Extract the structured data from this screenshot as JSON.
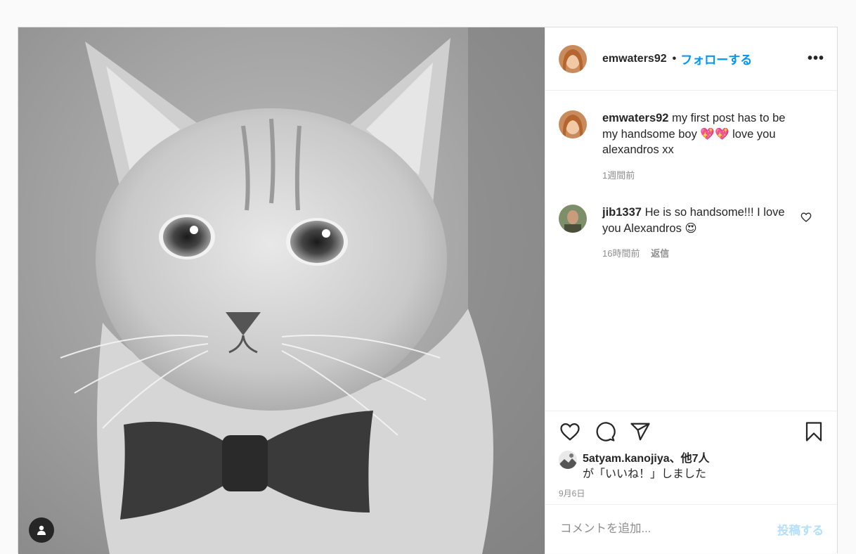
{
  "header": {
    "username": "emwaters92",
    "separator": "•",
    "follow_label": "フォローする",
    "more_label": "•••"
  },
  "caption": {
    "username": "emwaters92",
    "text": "my first post has to be my handsome boy 💖💖 love you alexandros xx",
    "time": "1週間前"
  },
  "comments": [
    {
      "username": "jib1337",
      "text": "He is so handsome!!! I love you Alexandros 😍",
      "time": "16時間前",
      "reply_label": "返信"
    }
  ],
  "likes": {
    "first_user": "5atyam.kanojiya",
    "joiner": "、",
    "others": "他7人",
    "suffix": "が「いいね！」しました"
  },
  "post_date": "9月6日",
  "comment_box": {
    "placeholder": "コメントを追加...",
    "post_label": "投稿する"
  },
  "colors": {
    "link_blue": "#0095f6",
    "post_disabled": "#b2dffc",
    "muted_text": "#8e8e8e"
  },
  "icons": [
    "heart-icon",
    "comment-icon",
    "share-icon",
    "bookmark-icon",
    "user-tag-icon",
    "more-options-icon"
  ]
}
